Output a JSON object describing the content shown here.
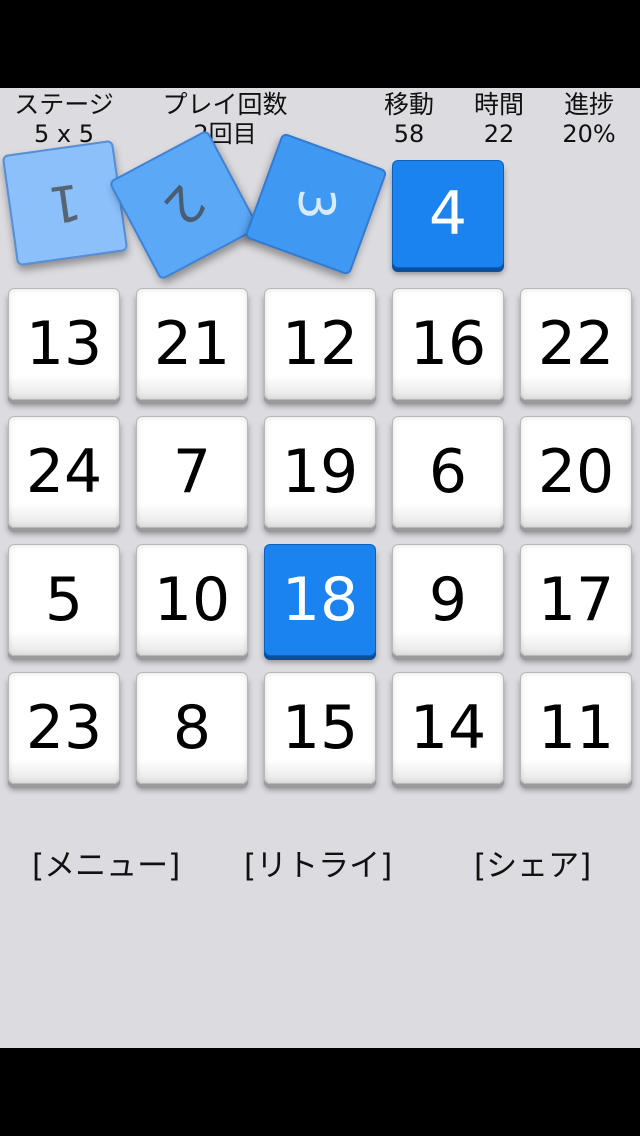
{
  "stats": {
    "stage": {
      "label": "ステージ",
      "value": "5 x 5"
    },
    "plays": {
      "label": "プレイ回数",
      "value": "2回目"
    },
    "moves": {
      "label": "移動",
      "value": "58"
    },
    "time": {
      "label": "時間",
      "value": "22"
    },
    "progress": {
      "label": "進捗",
      "value": "20%"
    }
  },
  "completed_tiles": [
    "1",
    "2",
    "3"
  ],
  "next_tile": "4",
  "board": [
    [
      "13",
      "21",
      "12",
      "16",
      "22"
    ],
    [
      "24",
      "7",
      "19",
      "6",
      "20"
    ],
    [
      "5",
      "10",
      "18",
      "9",
      "17"
    ],
    [
      "23",
      "8",
      "15",
      "14",
      "11"
    ]
  ],
  "highlighted_cell": "18",
  "menu": {
    "menu_label": "[メニュー]",
    "retry_label": "[リトライ]",
    "share_label": "[シェア]"
  },
  "colors": {
    "accent_blue": "#1a83f0",
    "background": "#dcdce0"
  }
}
